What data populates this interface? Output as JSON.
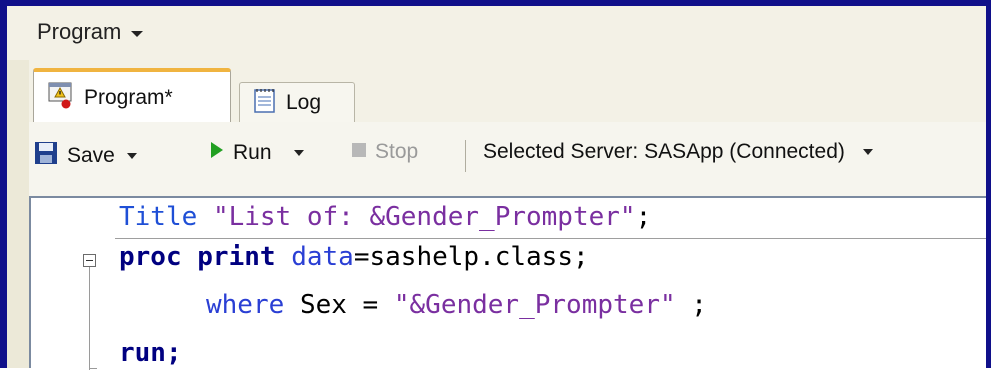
{
  "menubar": {
    "menu_label": "Program"
  },
  "tabs": [
    {
      "label": "Program*",
      "icon": "program-file-warning-icon"
    },
    {
      "label": "Log",
      "icon": "log-notepad-icon"
    }
  ],
  "toolbar": {
    "save_label": "Save",
    "run_label": "Run",
    "stop_label": "Stop",
    "server_label": "Selected Server: SASApp (Connected)"
  },
  "code": {
    "line1_kw": "Title",
    "line1_str": "\"List of: &Gender_Prompter\"",
    "line1_end": ";",
    "line2_kw1": "proc",
    "line2_kw2": "print",
    "line2_attr": "data",
    "line2_val": "=sashelp.class;",
    "line3_kw": "where",
    "line3_mid": "Sex = ",
    "line3_str": "\"&Gender_Prompter\"",
    "line3_end": " ;",
    "line4_kw": "run;"
  },
  "colors": {
    "frame": "#10108a",
    "active_tab_accent": "#f0b440",
    "run_green": "#22a022",
    "string": "#7a2fa0",
    "keyword": "#000080"
  }
}
